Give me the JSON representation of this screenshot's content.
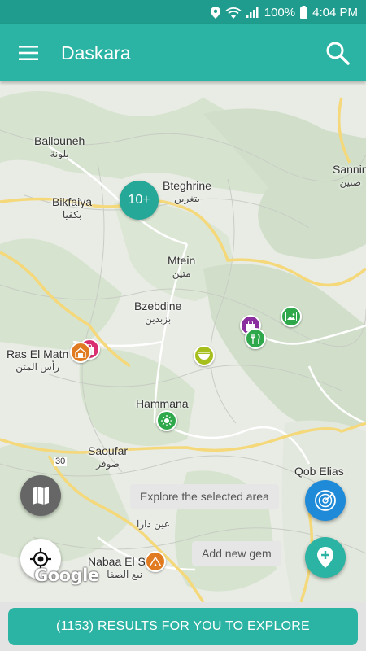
{
  "status_bar": {
    "battery": "100%",
    "time": "4:04 PM"
  },
  "app_bar": {
    "title": "Daskara"
  },
  "map": {
    "places": {
      "ballouneh": {
        "en": "Ballouneh",
        "ar": "بلونة"
      },
      "bikfaiya": {
        "en": "Bikfaiya",
        "ar": "بكفيا"
      },
      "bteghrine": {
        "en": "Bteghrine",
        "ar": "بتغرين"
      },
      "sannine": {
        "en": "Sannin",
        "ar": "صنين"
      },
      "mtein": {
        "en": "Mtein",
        "ar": "متين"
      },
      "bzebdine": {
        "en": "Bzebdine",
        "ar": "بزبدين"
      },
      "ras_el_matn": {
        "en": "Ras El Matn",
        "ar": "رأس المتن"
      },
      "hammana": {
        "en": "Hammana",
        "ar": ""
      },
      "saoufar": {
        "en": "Saoufar",
        "ar": "صوفر"
      },
      "qob_elias": {
        "en": "Qob Elias",
        "ar": ""
      },
      "nabaa_el_safa": {
        "en": "Nabaa El Safa",
        "ar": "نبع الصفا"
      },
      "dar": {
        "en": "",
        "ar": "عين دارا"
      }
    },
    "road_number": "30",
    "cluster_label": "10+",
    "google_logo": "Google"
  },
  "actions": {
    "explore_label": "Explore the selected area",
    "add_gem_label": "Add new gem"
  },
  "bottom": {
    "results_label": "(1153) RESULTS FOR YOU TO EXPLORE"
  },
  "colors": {
    "primary": "#2bb3a3",
    "status": "#1f9c8d",
    "explore_fab": "#1e8ad8"
  }
}
